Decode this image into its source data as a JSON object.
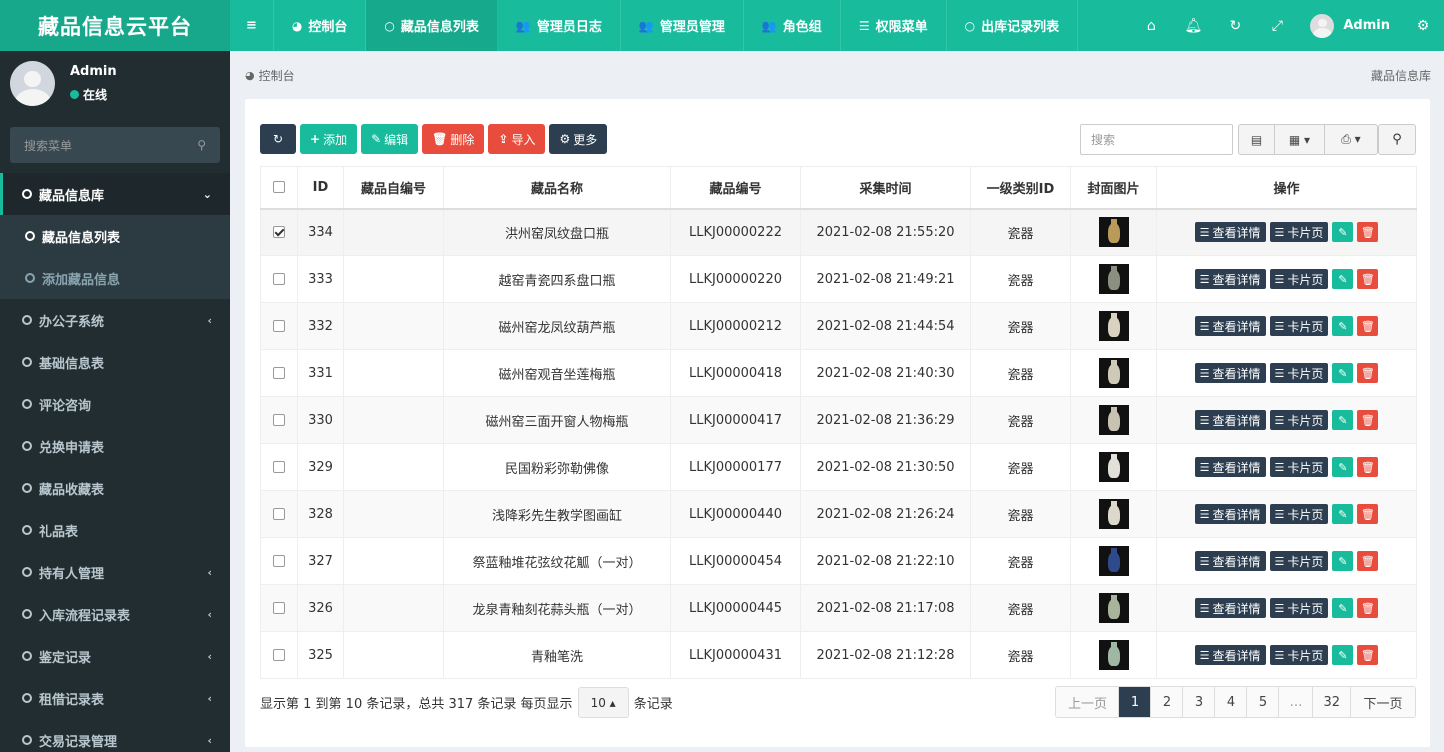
{
  "header": {
    "logo": "藏品信息云平台",
    "nav": [
      {
        "icon": "≡",
        "label": ""
      },
      {
        "icon": "◕",
        "label": "控制台"
      },
      {
        "icon": "○",
        "label": "藏品信息列表",
        "active": true
      },
      {
        "icon": "👥",
        "label": "管理员日志"
      },
      {
        "icon": "👥",
        "label": "管理员管理"
      },
      {
        "icon": "👥",
        "label": "角色组"
      },
      {
        "icon": "☰",
        "label": "权限菜单"
      },
      {
        "icon": "○",
        "label": "出库记录列表"
      }
    ],
    "user_name": "Admin"
  },
  "sidebar": {
    "user_name": "Admin",
    "status": "在线",
    "search_placeholder": "搜索菜单",
    "menu": [
      {
        "label": "藏品信息库",
        "open": true
      },
      {
        "label": "藏品信息列表",
        "sub": true,
        "active": true
      },
      {
        "label": "添加藏品信息",
        "sub": true
      },
      {
        "label": "办公子系统",
        "arrow": true
      },
      {
        "label": "基础信息表"
      },
      {
        "label": "评论咨询"
      },
      {
        "label": "兑换申请表"
      },
      {
        "label": "藏品收藏表"
      },
      {
        "label": "礼品表"
      },
      {
        "label": "持有人管理",
        "arrow": true
      },
      {
        "label": "入库流程记录表",
        "arrow": true
      },
      {
        "label": "鉴定记录",
        "arrow": true
      },
      {
        "label": "租借记录表",
        "arrow": true
      },
      {
        "label": "交易记录管理",
        "arrow": true
      }
    ]
  },
  "breadcrumb": {
    "home": "控制台",
    "right": "藏品信息库"
  },
  "toolbar": {
    "add": "添加",
    "edit": "编辑",
    "delete": "删除",
    "import": "导入",
    "more": "更多",
    "search_placeholder": "搜索"
  },
  "table": {
    "headers": [
      "ID",
      "藏品自编号",
      "藏品名称",
      "藏品编号",
      "采集时间",
      "一级类别ID",
      "封面图片",
      "操作"
    ],
    "detail_label": "查看详情",
    "card_label": "卡片页",
    "rows": [
      {
        "id": "334",
        "self_no": "",
        "name": "洪州窑凤纹盘口瓶",
        "code": "LLKJ00000222",
        "time": "2021-02-08 21:55:20",
        "cat": "瓷器",
        "checked": true,
        "color": "#b89a5a"
      },
      {
        "id": "333",
        "self_no": "",
        "name": "越窑青瓷四系盘口瓶",
        "code": "LLKJ00000220",
        "time": "2021-02-08 21:49:21",
        "cat": "瓷器",
        "color": "#8a8f80"
      },
      {
        "id": "332",
        "self_no": "",
        "name": "磁州窑龙凤纹葫芦瓶",
        "code": "LLKJ00000212",
        "time": "2021-02-08 21:44:54",
        "cat": "瓷器",
        "color": "#d9d2c0"
      },
      {
        "id": "331",
        "self_no": "",
        "name": "磁州窑观音坐莲梅瓶",
        "code": "LLKJ00000418",
        "time": "2021-02-08 21:40:30",
        "cat": "瓷器",
        "color": "#cfc9b8"
      },
      {
        "id": "330",
        "self_no": "",
        "name": "磁州窑三面开窗人物梅瓶",
        "code": "LLKJ00000417",
        "time": "2021-02-08 21:36:29",
        "cat": "瓷器",
        "color": "#c8c2b2"
      },
      {
        "id": "329",
        "self_no": "",
        "name": "民国粉彩弥勒佛像",
        "code": "LLKJ00000177",
        "time": "2021-02-08 21:30:50",
        "cat": "瓷器",
        "color": "#e2e0d8"
      },
      {
        "id": "328",
        "self_no": "",
        "name": "浅降彩先生教学图画缸",
        "code": "LLKJ00000440",
        "time": "2021-02-08 21:26:24",
        "cat": "瓷器",
        "color": "#dcd8cc"
      },
      {
        "id": "327",
        "self_no": "",
        "name": "祭蓝釉堆花弦纹花觚（一对）",
        "code": "LLKJ00000454",
        "time": "2021-02-08 21:22:10",
        "cat": "瓷器",
        "color": "#2f4a8a"
      },
      {
        "id": "326",
        "self_no": "",
        "name": "龙泉青釉刻花蒜头瓶（一对）",
        "code": "LLKJ00000445",
        "time": "2021-02-08 21:17:08",
        "cat": "瓷器",
        "color": "#a9b49c"
      },
      {
        "id": "325",
        "self_no": "",
        "name": "青釉笔洗",
        "code": "LLKJ00000431",
        "time": "2021-02-08 21:12:28",
        "cat": "瓷器",
        "color": "#9fb8a4"
      }
    ]
  },
  "pagination": {
    "info": "显示第 1 到第 10 条记录，总共 317 条记录 每页显示",
    "page_size": "10",
    "suffix": "条记录",
    "prev": "上一页",
    "next": "下一页",
    "pages": [
      "1",
      "2",
      "3",
      "4",
      "5",
      "…",
      "32"
    ]
  }
}
